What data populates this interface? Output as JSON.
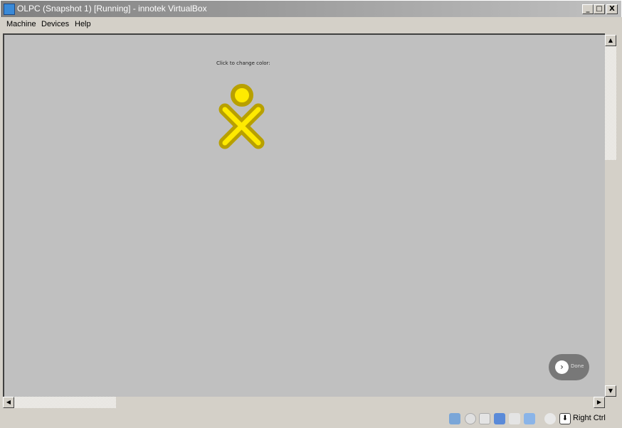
{
  "window": {
    "title": "OLPC (Snapshot 1) [Running] - innotek VirtualBox",
    "minimize": "_",
    "maximize": "□",
    "close": "X"
  },
  "menu": [
    "Machine",
    "Devices",
    "Help"
  ],
  "guest": {
    "prompt": "Click to change color:",
    "done_label": "Done",
    "icon_fill": "#ffea00",
    "icon_stroke": "#b8a000",
    "background": "#c0c0c0"
  },
  "status": {
    "icons": [
      "hard-disk-icon",
      "cd-icon",
      "floppy-icon",
      "network-icon",
      "usb-icon",
      "shared-folder-icon",
      "mouse-integration-icon",
      "host-key-icon"
    ],
    "host_key": "Right Ctrl"
  }
}
